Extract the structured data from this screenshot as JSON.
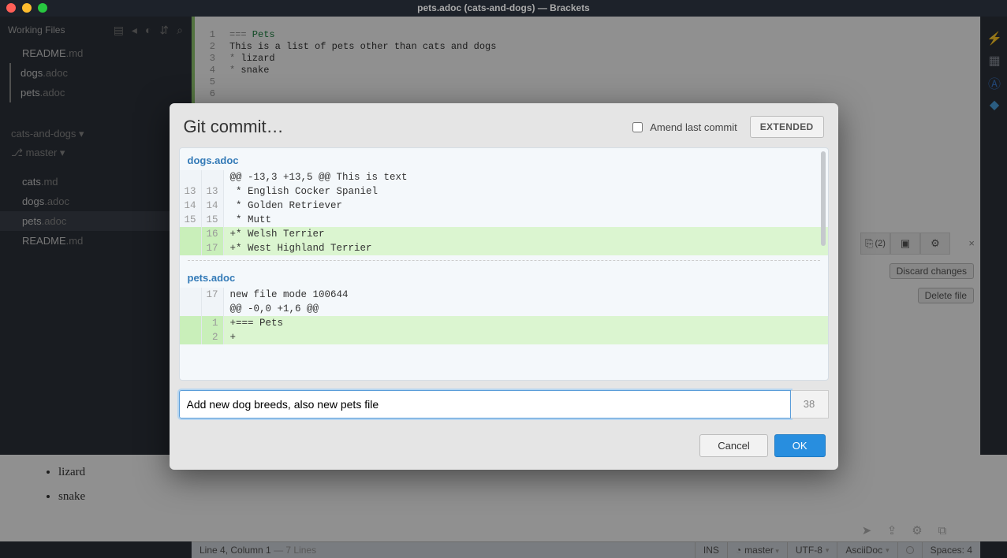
{
  "titlebar": "pets.adoc (cats-and-dogs) — Brackets",
  "sidebar": {
    "working_header": "Working Files",
    "working": [
      {
        "name": "README",
        "ext": ".md"
      },
      {
        "name": "dogs",
        "ext": ".adoc"
      },
      {
        "name": "pets",
        "ext": ".adoc"
      }
    ],
    "project": "cats-and-dogs ▾",
    "branch": "⎇ master ▾",
    "files": [
      {
        "name": "cats",
        "ext": ".md",
        "selected": false
      },
      {
        "name": "dogs",
        "ext": ".adoc",
        "selected": false
      },
      {
        "name": "pets",
        "ext": ".adoc",
        "selected": true
      },
      {
        "name": "README",
        "ext": ".md",
        "selected": false
      }
    ]
  },
  "editor": {
    "code": [
      {
        "n": 1,
        "op": "===",
        "txt": " Pets"
      },
      {
        "n": 2,
        "txt": ""
      },
      {
        "n": 3,
        "txt": "This is a list of pets other than cats and dogs"
      },
      {
        "n": 4,
        "txt": ""
      },
      {
        "n": 5,
        "op": "*",
        "txt": " lizard"
      },
      {
        "n": 6,
        "op": "*",
        "txt": " snake"
      }
    ]
  },
  "preview": [
    "lizard",
    "snake"
  ],
  "git_panel": {
    "badge": "(2)",
    "discard": "Discard changes",
    "delete": "Delete file"
  },
  "status": {
    "pos": "Line 4, Column 1",
    "lines": " — 7 Lines",
    "ins": "INS",
    "branch": "master",
    "enc": "UTF-8",
    "lang": "AsciiDoc",
    "spaces": "Spaces:  4"
  },
  "modal": {
    "title": "Git commit…",
    "amend": "Amend last commit",
    "extended": "EXTENDED",
    "file1": "dogs.adoc",
    "file2": "pets.adoc",
    "diff1": [
      {
        "l": "",
        "r": "",
        "t": "@@ -13,3 +13,5 @@ This is text",
        "a": false
      },
      {
        "l": "13",
        "r": "13",
        "t": " * English Cocker Spaniel",
        "a": false
      },
      {
        "l": "14",
        "r": "14",
        "t": " * Golden Retriever",
        "a": false
      },
      {
        "l": "15",
        "r": "15",
        "t": " * Mutt",
        "a": false
      },
      {
        "l": "",
        "r": "16",
        "t": "+* Welsh Terrier",
        "a": true
      },
      {
        "l": "",
        "r": "17",
        "t": "+* West Highland Terrier",
        "a": true
      }
    ],
    "diff2": [
      {
        "l": "",
        "r": "17",
        "t": "new file mode 100644",
        "a": false
      },
      {
        "l": "",
        "r": "",
        "t": "@@ -0,0 +1,6 @@",
        "a": false
      },
      {
        "l": "",
        "r": "1",
        "t": "+=== Pets",
        "a": true
      },
      {
        "l": "",
        "r": "2",
        "t": "+",
        "a": true
      }
    ],
    "msg": "Add new dog breeds, also new pets file",
    "count": "38",
    "cancel": "Cancel",
    "ok": "OK"
  }
}
